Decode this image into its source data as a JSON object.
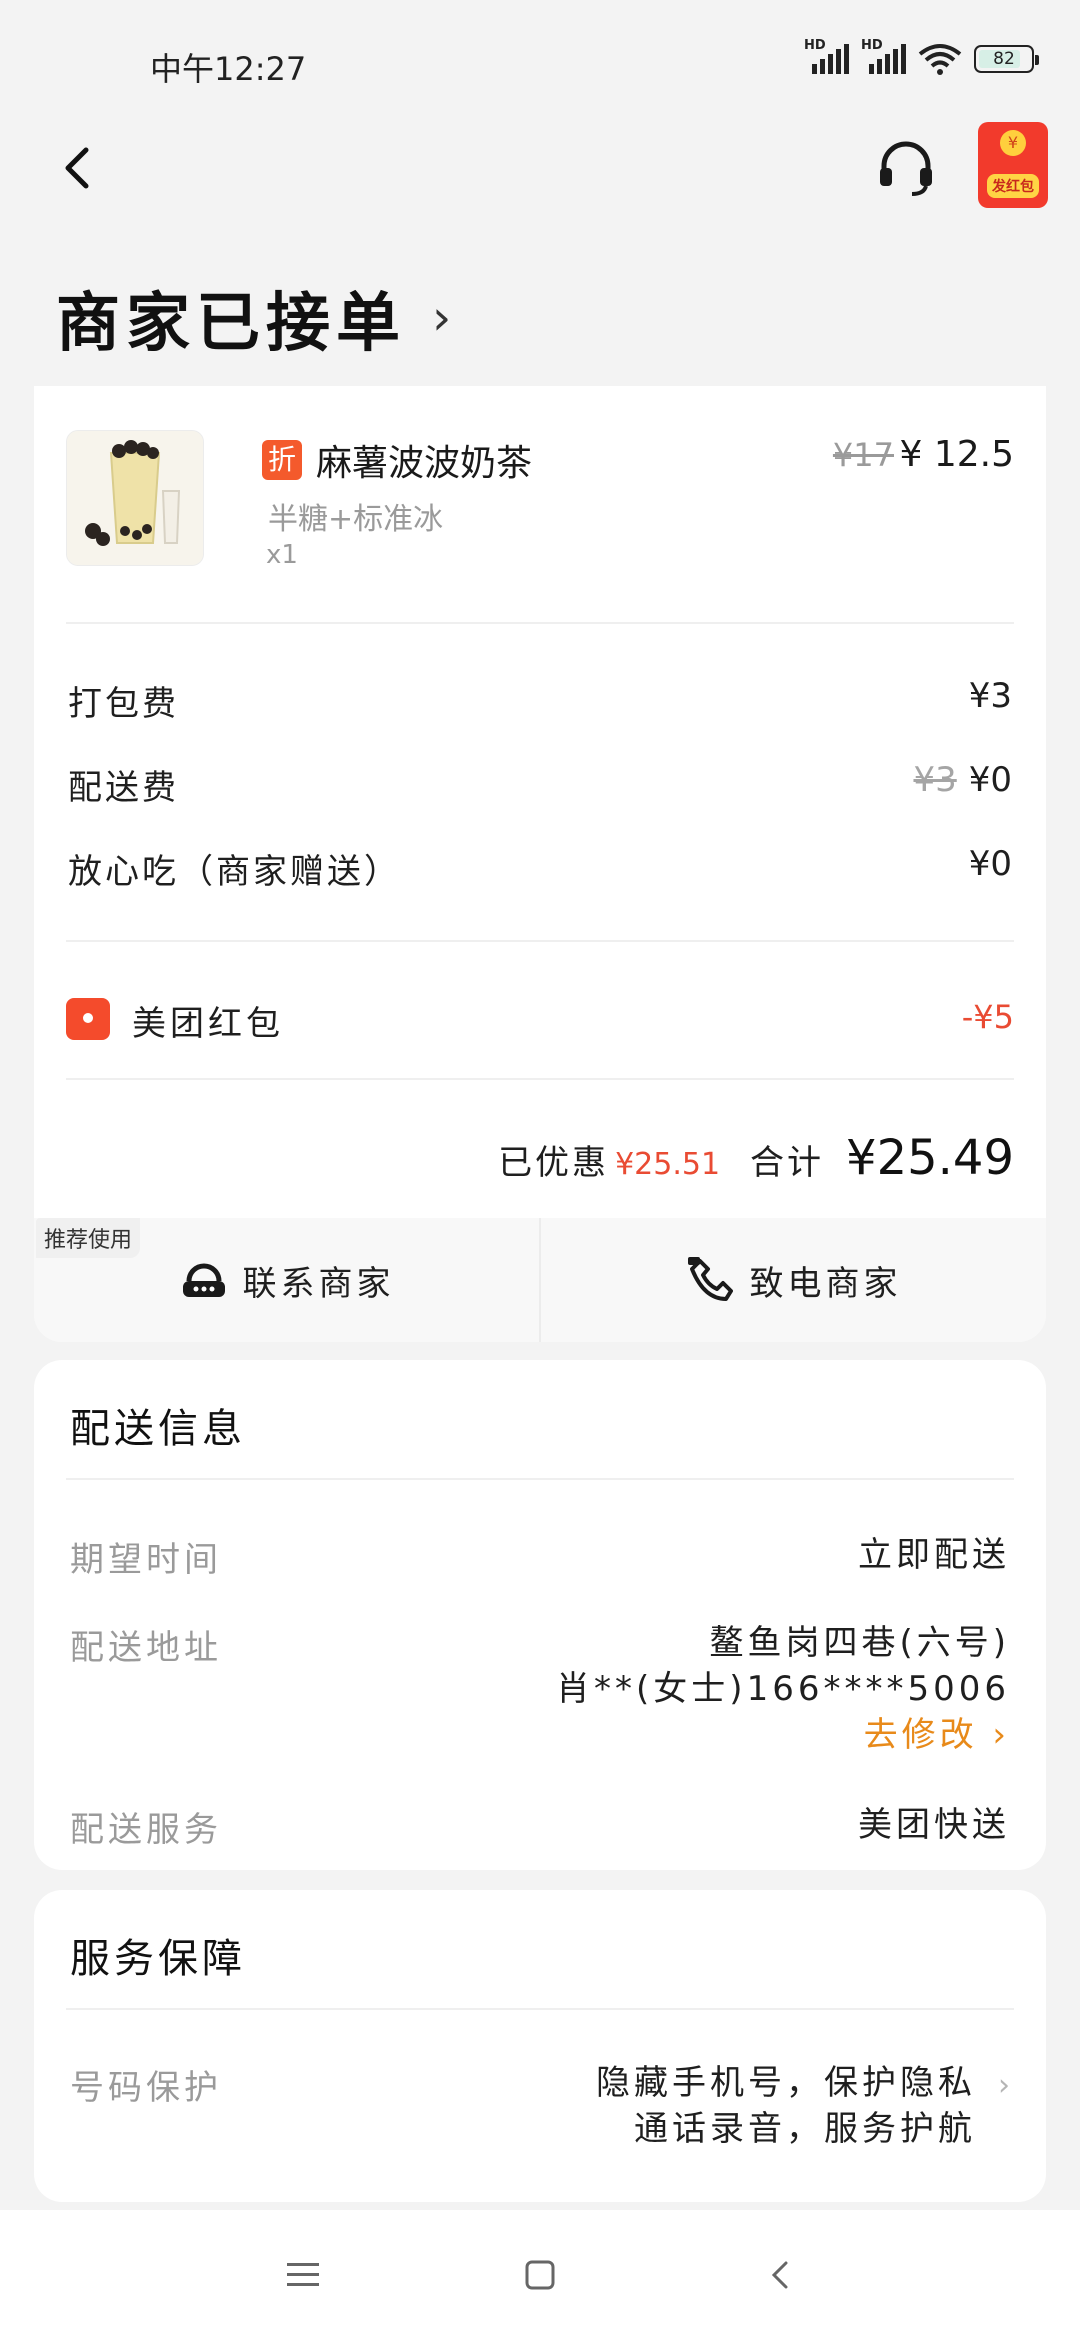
{
  "status_bar": {
    "time": "中午12:27",
    "signal1": "HD",
    "signal2": "HD",
    "battery": "82"
  },
  "top_nav": {
    "back_icon": "chevron-left-icon",
    "support_icon": "headset-icon",
    "red_packet_label": "发红包"
  },
  "order_status": {
    "title": "商家已接单",
    "chevron": "›"
  },
  "product": {
    "discount_tag": "折",
    "name": "麻薯波波奶茶",
    "spec": "半糖+标准冰",
    "quantity": "x1",
    "original_price": "¥17",
    "price": "¥ 12.5"
  },
  "fees": [
    {
      "label": "打包费",
      "original": "",
      "value": "¥3"
    },
    {
      "label": "配送费",
      "original": "¥3",
      "value": "¥0"
    },
    {
      "label": "放心吃（商家赠送）",
      "original": "",
      "value": "¥0"
    }
  ],
  "coupon": {
    "label": "美团红包",
    "value": "-¥5"
  },
  "total": {
    "saved_label": "已优惠",
    "saved_value": "¥25.51",
    "sum_label": "合计",
    "sum_value": "¥25.49"
  },
  "contact": {
    "recommend_tag": "推荐使用",
    "chat_label": "联系商家",
    "call_label": "致电商家"
  },
  "delivery": {
    "title": "配送信息",
    "time_label": "期望时间",
    "time_value": "立即配送",
    "address_label": "配送地址",
    "address_line1": "鳌鱼岗四巷(六号)",
    "address_line2": "肖**(女士)166****5006",
    "edit_label": "去修改",
    "service_label": "配送服务",
    "service_value": "美团快送"
  },
  "service": {
    "title": "服务保障",
    "label": "号码保护",
    "line1": "隐藏手机号，保护隐私",
    "line2": "通话录音，服务护航"
  },
  "accent_color": "#e94b33",
  "link_color": "#e88a1a"
}
